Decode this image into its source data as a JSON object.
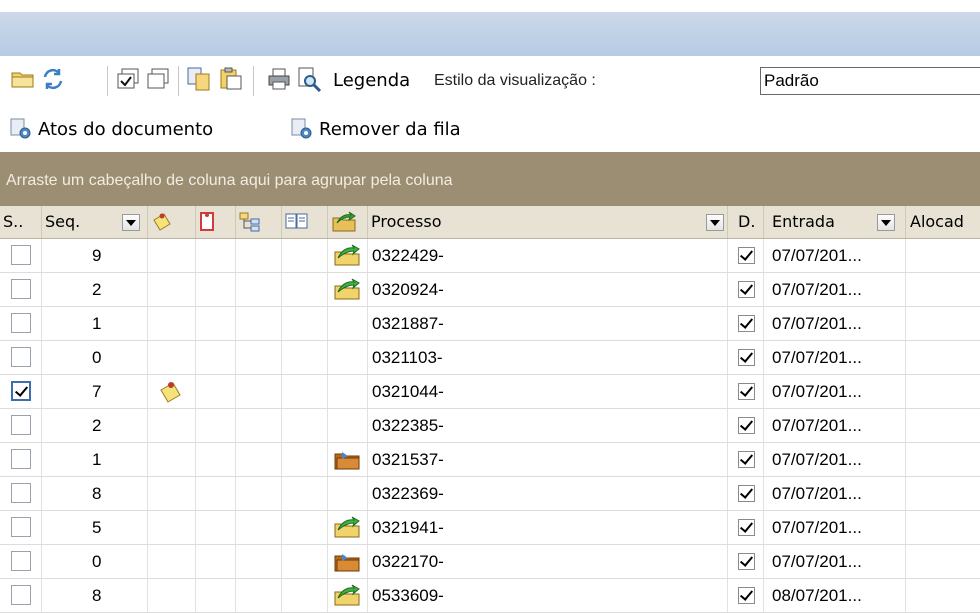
{
  "toolbar": {
    "legend_label": "Legenda",
    "style_label": "Estilo da visualização :",
    "style_value": "Padrão",
    "icons": [
      "folder-icon",
      "refresh-icon",
      "check-all-icon",
      "uncheck-all-icon",
      "copy-icon",
      "paste-icon",
      "print-icon",
      "search-document-icon"
    ]
  },
  "actions": {
    "document_acts_label": "Atos do documento",
    "remove_from_queue_label": "Remover da fila"
  },
  "group_bar": {
    "text": "Arraste um cabeçalho de coluna aqui para agrupar pela coluna"
  },
  "columns": {
    "select": "S..",
    "seq": "Seq.",
    "process": "Processo",
    "d": "D.",
    "entrada": "Entrada",
    "alocado": "Alocad"
  },
  "rows": [
    {
      "selected": false,
      "seq": "9",
      "note": false,
      "flag": "green-arrow",
      "process": "0322429-",
      "d_checked": true,
      "entrada": "07/07/201..."
    },
    {
      "selected": false,
      "seq": "2",
      "note": false,
      "flag": "green-arrow",
      "process": "0320924-",
      "d_checked": true,
      "entrada": "07/07/201..."
    },
    {
      "selected": false,
      "seq": "1",
      "note": false,
      "flag": "none",
      "process": "0321887-",
      "d_checked": true,
      "entrada": "07/07/201..."
    },
    {
      "selected": false,
      "seq": "0",
      "note": false,
      "flag": "none",
      "process": "0321103-",
      "d_checked": true,
      "entrada": "07/07/201..."
    },
    {
      "selected": true,
      "seq": "7",
      "note": true,
      "flag": "none",
      "process": "0321044-",
      "d_checked": true,
      "entrada": "07/07/201..."
    },
    {
      "selected": false,
      "seq": "2",
      "note": false,
      "flag": "none",
      "process": "0322385-",
      "d_checked": true,
      "entrada": "07/07/201..."
    },
    {
      "selected": false,
      "seq": "1",
      "note": false,
      "flag": "brown-folder",
      "process": "0321537-",
      "d_checked": true,
      "entrada": "07/07/201..."
    },
    {
      "selected": false,
      "seq": "8",
      "note": false,
      "flag": "none",
      "process": "0322369-",
      "d_checked": true,
      "entrada": "07/07/201..."
    },
    {
      "selected": false,
      "seq": "5",
      "note": false,
      "flag": "green-arrow",
      "process": "0321941-",
      "d_checked": true,
      "entrada": "07/07/201..."
    },
    {
      "selected": false,
      "seq": "0",
      "note": false,
      "flag": "brown-folder",
      "process": "0322170-",
      "d_checked": true,
      "entrada": "07/07/201..."
    },
    {
      "selected": false,
      "seq": "8",
      "note": false,
      "flag": "green-arrow",
      "process": "0533609-",
      "d_checked": true,
      "entrada": "08/07/201..."
    }
  ]
}
